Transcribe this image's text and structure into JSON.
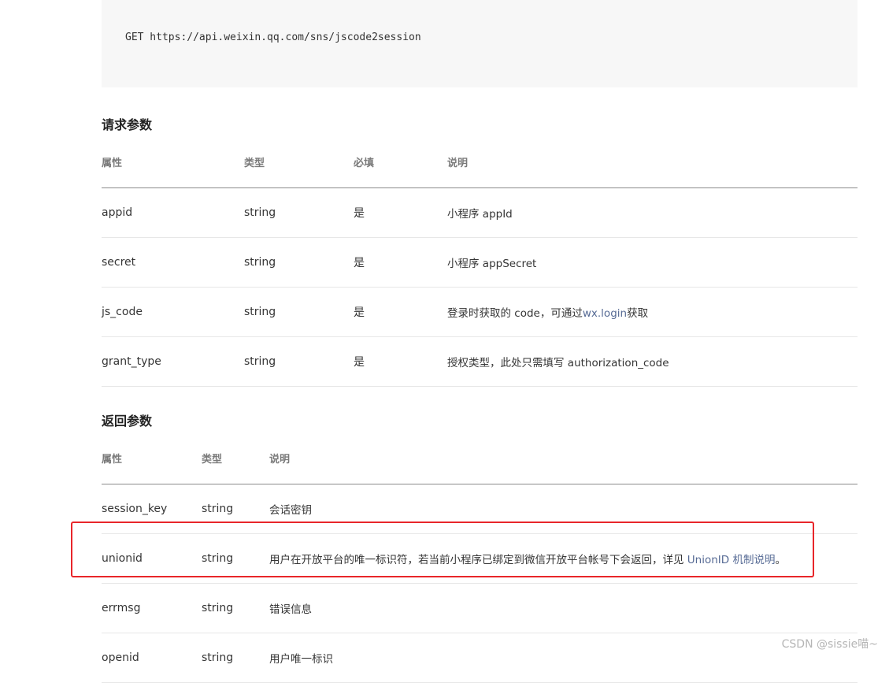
{
  "code": {
    "text": "GET https://api.weixin.qq.com/sns/jscode2session"
  },
  "request": {
    "title": "请求参数",
    "headers": {
      "attr": "属性",
      "type": "类型",
      "required": "必填",
      "desc": "说明"
    },
    "rows": [
      {
        "name": "appid",
        "type": "string",
        "required": "是",
        "desc": "小程序 appId"
      },
      {
        "name": "secret",
        "type": "string",
        "required": "是",
        "desc": "小程序 appSecret"
      },
      {
        "name": "js_code",
        "type": "string",
        "required": "是",
        "desc_prefix": "登录时获取的 code，可通过",
        "desc_link": "wx.login",
        "desc_suffix": "获取"
      },
      {
        "name": "grant_type",
        "type": "string",
        "required": "是",
        "desc": "授权类型，此处只需填写 authorization_code"
      }
    ]
  },
  "response": {
    "title": "返回参数",
    "headers": {
      "attr": "属性",
      "type": "类型",
      "desc": "说明"
    },
    "rows": [
      {
        "name": "session_key",
        "type": "string",
        "desc": "会话密钥"
      },
      {
        "name": "unionid",
        "type": "string",
        "desc_prefix": "用户在开放平台的唯一标识符，若当前小程序已绑定到微信开放平台帐号下会返回，详见 ",
        "desc_link": "UnionID 机制说明",
        "desc_suffix": "。"
      },
      {
        "name": "errmsg",
        "type": "string",
        "desc": "错误信息"
      },
      {
        "name": "openid",
        "type": "string",
        "desc": "用户唯一标识"
      }
    ]
  },
  "watermark": {
    "text": "CSDN @sissie喵~"
  },
  "colors": {
    "link": "#576b95",
    "highlight": "#e8262a",
    "code_bg": "#f7f7f7"
  }
}
